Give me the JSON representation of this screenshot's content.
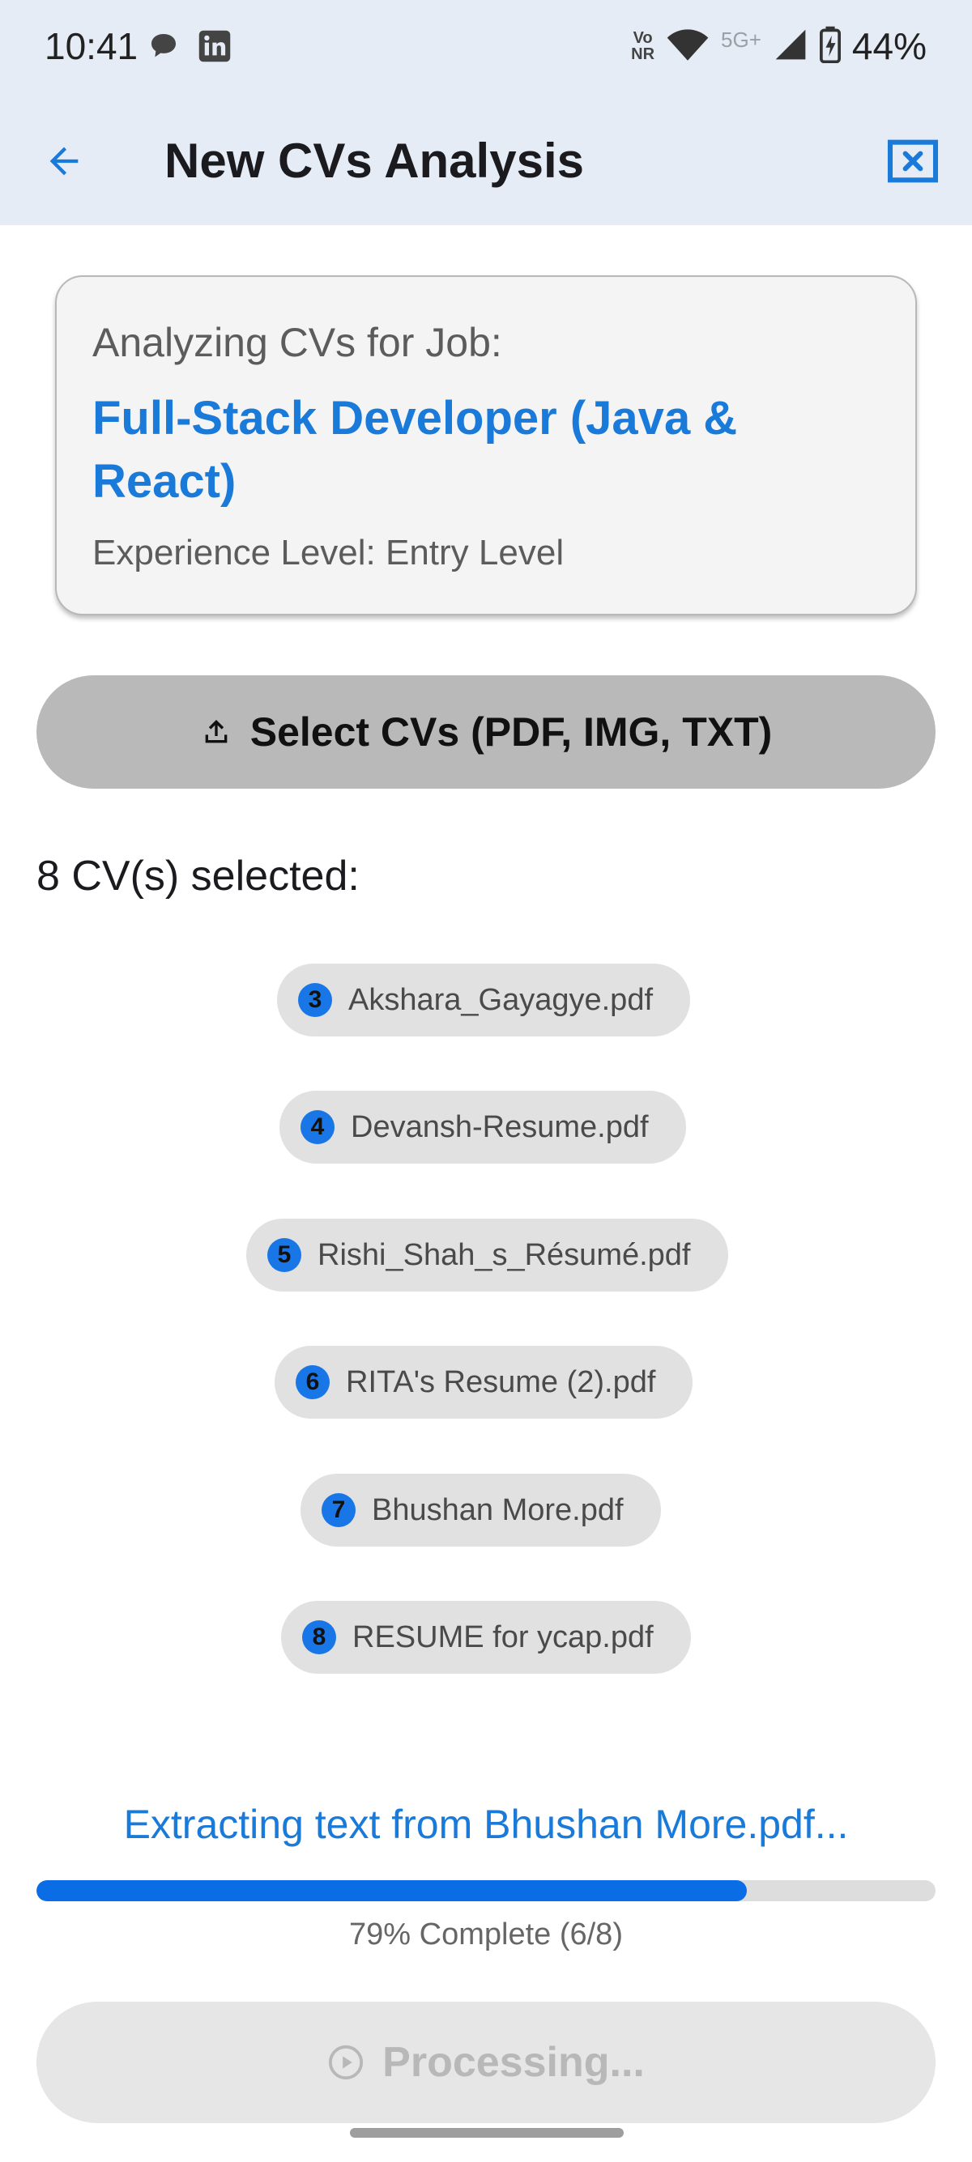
{
  "status_bar": {
    "time": "10:41",
    "left_icons": [
      "chat-bubble-icon",
      "linkedin-icon"
    ],
    "volte_top": "Vo",
    "volte_bottom": "NR",
    "network_label": "5G+",
    "battery_percent": "44%"
  },
  "app_bar": {
    "title": "New CVs Analysis",
    "back_icon": "arrow-left-icon",
    "close_icon": "close-box-icon",
    "accent_color": "#1a7ad9"
  },
  "job_card": {
    "label": "Analyzing CVs for Job:",
    "title": "Full-Stack Developer (Java & React)",
    "experience": "Experience Level: Entry Level"
  },
  "select_button": {
    "label": "Select CVs (PDF, IMG, TXT)",
    "icon": "upload-icon"
  },
  "selected_heading": "8 CV(s) selected:",
  "cv_files": [
    {
      "number": "3",
      "name": "Akshara_Gayagye.pdf"
    },
    {
      "number": "4",
      "name": "Devansh-Resume.pdf"
    },
    {
      "number": "5",
      "name": "Rishi_Shah_s_Résumé.pdf"
    },
    {
      "number": "6",
      "name": "RITA's Resume (2).pdf"
    },
    {
      "number": "7",
      "name": "Bhushan More.pdf"
    },
    {
      "number": "8",
      "name": "RESUME for ycap.pdf"
    }
  ],
  "progress": {
    "status": "Extracting text from Bhushan More.pdf...",
    "percent": 79,
    "label": "79% Complete (6/8)",
    "fill_color": "#0a6de6"
  },
  "processing_button": {
    "label": "Processing...",
    "icon": "play-circle-icon",
    "disabled": true
  }
}
